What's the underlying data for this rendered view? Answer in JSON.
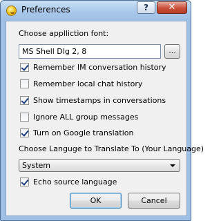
{
  "window": {
    "title": "Preferences",
    "help_label": "?",
    "close_label": "✕"
  },
  "font": {
    "label": "Choose applliction font:",
    "value": "MS Shell Dlg 2, 8",
    "browse_label": "..."
  },
  "options": [
    {
      "label": "Remember IM conversation history",
      "checked": true
    },
    {
      "label": "Remember local chat history",
      "checked": false
    },
    {
      "label": "Show timestamps in conversations",
      "checked": true
    },
    {
      "label": "Ignore ALL group messages",
      "checked": false
    },
    {
      "label": "Turn on Google translation",
      "checked": true
    }
  ],
  "language": {
    "label": "Choose Languge to Translate To (Your Language)",
    "selected": "System"
  },
  "echo": {
    "label": "Echo source language",
    "checked": true
  },
  "buttons": {
    "ok": "OK",
    "cancel": "Cancel"
  }
}
